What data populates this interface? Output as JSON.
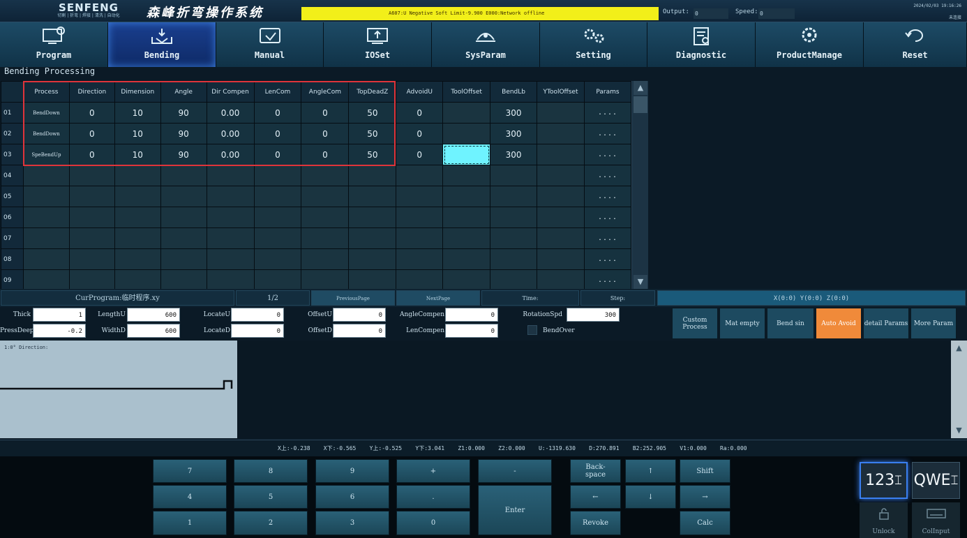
{
  "header": {
    "brand": "SENFENG",
    "brand_sub": "切割 | 折弯 | 焊接 | 清洗 | 自动化",
    "system_title": "森峰折弯操作系统",
    "alarm_text": "A607:U Negative Soft Limit-9.900    E000:Network offline",
    "output_label": "Output:",
    "output_value": "0",
    "speed_label": "Speed:",
    "speed_value": "0",
    "datetime": "2024/02/03 19:16:26",
    "lang": "未连接"
  },
  "nav": [
    {
      "label": "Program",
      "icon": "program-icon",
      "active": false
    },
    {
      "label": "Bending",
      "icon": "bending-icon",
      "active": true
    },
    {
      "label": "Manual",
      "icon": "manual-icon",
      "active": false
    },
    {
      "label": "IOSet",
      "icon": "ioset-icon",
      "active": false
    },
    {
      "label": "SysParam",
      "icon": "sysparam-icon",
      "active": false
    },
    {
      "label": "Setting",
      "icon": "setting-icon",
      "active": false
    },
    {
      "label": "Diagnostic",
      "icon": "diagnostic-icon",
      "active": false
    },
    {
      "label": "ProductManage",
      "icon": "productmanage-icon",
      "active": false
    },
    {
      "label": "Reset",
      "icon": "reset-icon",
      "active": false
    }
  ],
  "section_title": "Bending Processing",
  "table": {
    "columns": [
      "Process",
      "Direction",
      "Dimension",
      "Angle",
      "Dir Compen",
      "LenCom",
      "AngleCom",
      "TopDeadZ",
      "AdvoidU",
      "ToolOffset",
      "BendLb",
      "YToolOffset",
      "Params"
    ],
    "rows": [
      {
        "no": "01",
        "cells": [
          "BendDown",
          "0",
          "10",
          "90",
          "0.00",
          "0",
          "0",
          "50",
          "0",
          "",
          "300",
          "",
          "...."
        ]
      },
      {
        "no": "02",
        "cells": [
          "BendDown",
          "0",
          "10",
          "90",
          "0.00",
          "0",
          "0",
          "50",
          "0",
          "",
          "300",
          "",
          "...."
        ]
      },
      {
        "no": "03",
        "cells": [
          "SpeBendUp",
          "0",
          "10",
          "90",
          "0.00",
          "0",
          "0",
          "50",
          "0",
          "",
          "300",
          "",
          "...."
        ]
      },
      {
        "no": "04",
        "cells": [
          "",
          "",
          "",
          "",
          "",
          "",
          "",
          "",
          "",
          "",
          "",
          "",
          "...."
        ]
      },
      {
        "no": "05",
        "cells": [
          "",
          "",
          "",
          "",
          "",
          "",
          "",
          "",
          "",
          "",
          "",
          "",
          "...."
        ]
      },
      {
        "no": "06",
        "cells": [
          "",
          "",
          "",
          "",
          "",
          "",
          "",
          "",
          "",
          "",
          "",
          "",
          "...."
        ]
      },
      {
        "no": "07",
        "cells": [
          "",
          "",
          "",
          "",
          "",
          "",
          "",
          "",
          "",
          "",
          "",
          "",
          "...."
        ]
      },
      {
        "no": "08",
        "cells": [
          "",
          "",
          "",
          "",
          "",
          "",
          "",
          "",
          "",
          "",
          "",
          "",
          "...."
        ]
      },
      {
        "no": "09",
        "cells": [
          "",
          "",
          "",
          "",
          "",
          "",
          "",
          "",
          "",
          "",
          "",
          "",
          "...."
        ]
      }
    ]
  },
  "infobar": {
    "cur_program": "CurProgram:临时程序.xy",
    "page": "1/2",
    "prev": "PreviousPage",
    "next": "NextPage",
    "time": "Time:",
    "step": "Step:",
    "coords": "X(0:0) Y(0:0) Z(0:0)"
  },
  "params": {
    "thick_label": "Thick",
    "thick": "1",
    "press_label": "PressDeep",
    "press": "-0.2",
    "lengthu_label": "LengthU",
    "lengthu": "600",
    "widthd_label": "WidthD",
    "widthd": "600",
    "locateu_label": "LocateU",
    "locateu": "0",
    "located_label": "LocateD",
    "located": "0",
    "offsetu_label": "OffsetU",
    "offsetu": "0",
    "offsetd_label": "OffsetD",
    "offsetd": "0",
    "anglecompen_label": "AngleCompen",
    "anglecompen": "0",
    "lencompen_label": "LenCompen",
    "lencompen": "0",
    "rotationspd_label": "RotationSpd",
    "rotationspd": "300",
    "bendover_label": "BendOver"
  },
  "function_buttons": [
    {
      "label": "Custom Process",
      "highlight": false
    },
    {
      "label": "Mat empty",
      "highlight": false
    },
    {
      "label": "Bend sin",
      "highlight": false
    },
    {
      "label": "Auto Avoid",
      "highlight": true
    },
    {
      "label": "detail Params",
      "highlight": false
    },
    {
      "label": "More Param",
      "highlight": false
    }
  ],
  "preview": {
    "caption": "1:0° Direction:"
  },
  "axis_readout": "X上:-0.238    X下:-0.565    Y上:-0.525    Y下:3.041    Z1:0.000    Z2:0.000    U:-1319.630    D:270.891    B2:252.905    V1:0.000    Ra:0.000",
  "keypad": {
    "num": [
      "7",
      "8",
      "9",
      "+",
      "-",
      "4",
      "5",
      "6",
      ".",
      "1",
      "2",
      "3",
      "0"
    ],
    "enter": "Enter",
    "backspace": "Back-space",
    "up": "↑",
    "shift": "Shift",
    "left": "←",
    "down": "↓",
    "right": "→",
    "revoke": "Revoke",
    "calc": "Calc",
    "ime_num": "123",
    "ime_alpha": "QWE",
    "unlock": "Unlock",
    "colinput": "ColInput"
  }
}
